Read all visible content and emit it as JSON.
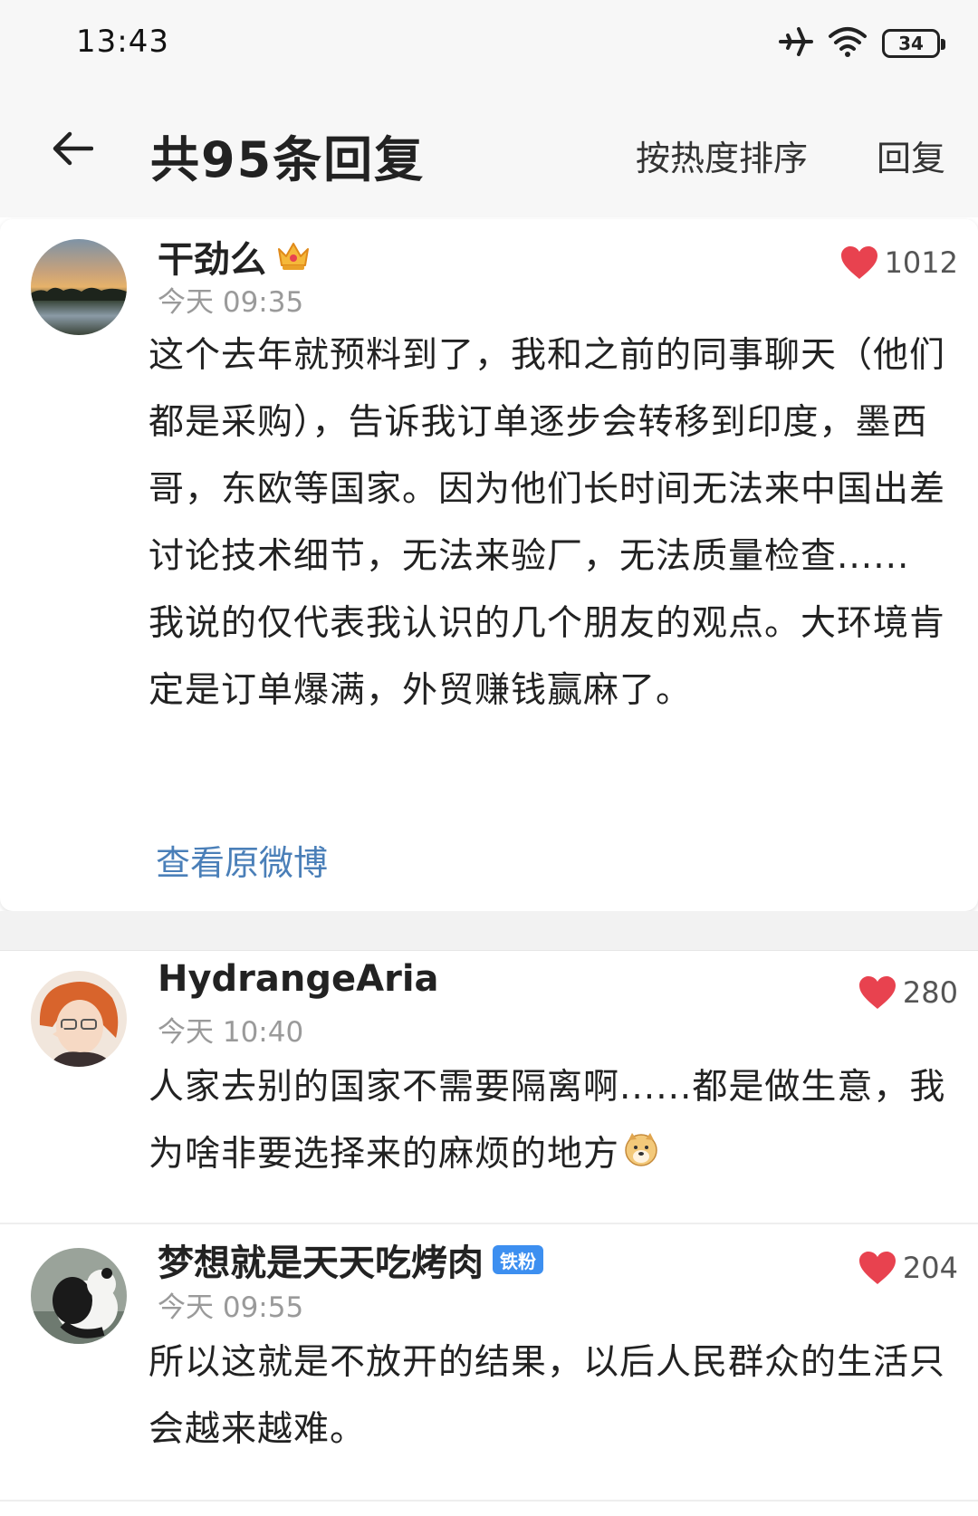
{
  "status_bar": {
    "time": "13:43",
    "battery": "34",
    "icons": [
      "airplane-icon",
      "wifi-icon",
      "battery-icon"
    ]
  },
  "header": {
    "title": "共95条回复",
    "sort_label": "按热度排序",
    "reply_label": "回复",
    "back_icon": "back-arrow-icon"
  },
  "comments": [
    {
      "user": "干劲么",
      "badge_icon": "crown-badge-icon",
      "time": "今天 09:35",
      "likes": "1012",
      "text": "这个去年就预料到了，我和之前的同事聊天（他们都是采购），告诉我订单逐步会转移到印度，墨西哥，东欧等国家。因为他们长时间无法来中国出差讨论技术细节，无法来验厂，无法质量检查......我说的仅代表我认识的几个朋友的观点。大环境肯定是订单爆满，外贸赚钱赢麻了。",
      "link": "查看原微博"
    },
    {
      "user": "HydrangeAria",
      "time": "今天 10:40",
      "likes": "280",
      "text": "人家去别的国家不需要隔离啊......都是做生意，我为啥非要选择来的麻烦的地方",
      "emoji_icon": "doge-emoji-icon"
    },
    {
      "user": "梦想就是天天吃烤肉",
      "badge": "铁粉",
      "time": "今天 09:55",
      "likes": "204",
      "text": "所以这就是不放开的结果，以后人民群众的生活只会越来越难。"
    }
  ],
  "colors": {
    "like": "#e8424f",
    "link": "#4a7fb8",
    "fan_badge": "#3d8ff0"
  }
}
